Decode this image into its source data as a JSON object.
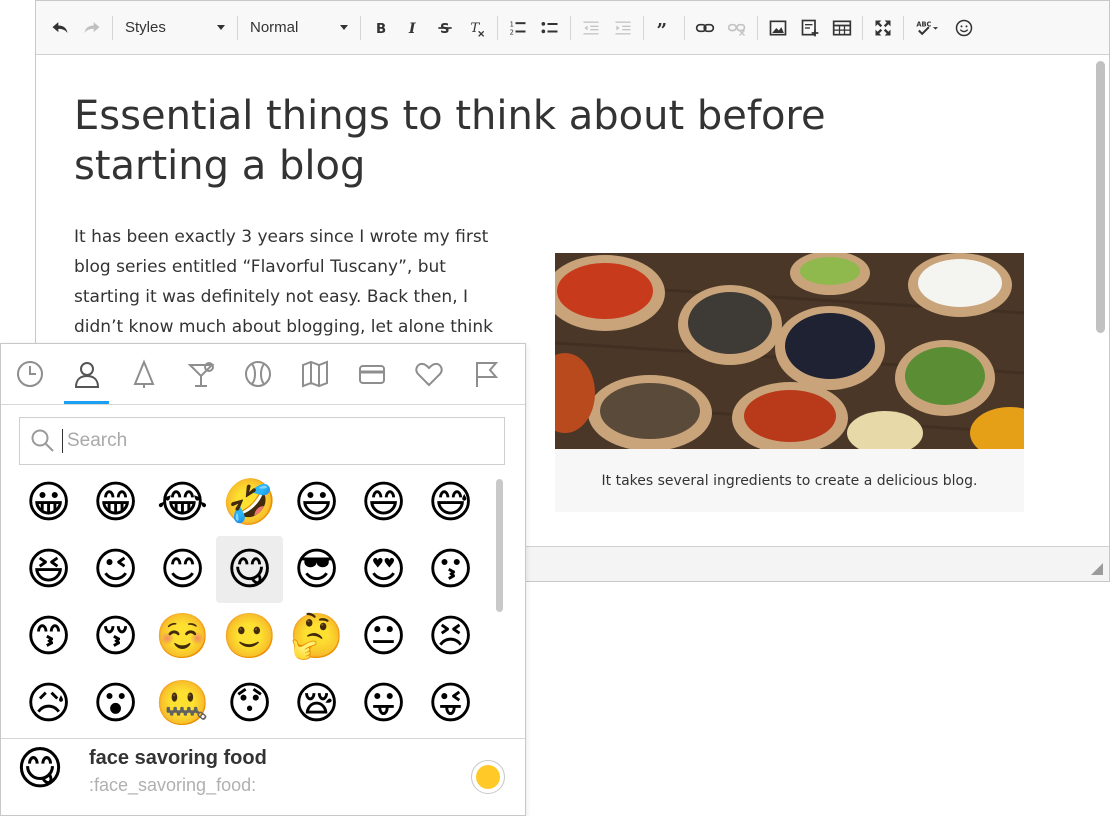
{
  "toolbar": {
    "styles_label": "Styles",
    "format_label": "Normal",
    "spellcheck_label": "ABC",
    "icons": [
      "undo-icon",
      "redo-icon",
      "bold-icon",
      "italic-icon",
      "strikethrough-icon",
      "remove-format-icon",
      "numbered-list-icon",
      "bulleted-list-icon",
      "decrease-indent-icon",
      "increase-indent-icon",
      "blockquote-icon",
      "link-icon",
      "unlink-icon",
      "image-icon",
      "embed-icon",
      "table-icon",
      "maximize-icon",
      "spellcheck-icon",
      "emoji-icon"
    ]
  },
  "article": {
    "title": "Essential things to think about before starting a blog",
    "paragraph": "It has been exactly 3 years since I wrote my first blog series entitled “Flavorful Tuscany”, but starting it was definitely not easy. Back then, I didn’t know much about blogging, let alone think",
    "figure_caption": "It takes several ingredients to create a delicious blog."
  },
  "emoji_panel": {
    "categories": [
      "recent-icon",
      "people-icon",
      "nature-icon",
      "food-drink-icon",
      "activity-icon",
      "travel-icon",
      "objects-icon",
      "symbols-icon",
      "flags-icon"
    ],
    "active_category": "people-icon",
    "search": {
      "placeholder": "Search",
      "value": ""
    },
    "emojis": [
      "😀",
      "😁",
      "😂",
      "🤣",
      "😃",
      "😄",
      "😅",
      "😆",
      "😉",
      "😊",
      "😋",
      "😎",
      "😍",
      "😗",
      "😙",
      "😚",
      "☺️",
      "🙂",
      "🤔",
      "😐",
      "😣",
      "😥",
      "😮",
      "🤐",
      "😯",
      "😪",
      "😛",
      "😜"
    ],
    "selected_emoji": "😋",
    "preview": {
      "emoji": "😋",
      "name": "face savoring food",
      "shortcode": ":face_savoring_food:"
    },
    "skin_tone_color": "#ffca28"
  },
  "colors": {
    "accent": "#1a9ff1",
    "text": "#333333"
  }
}
